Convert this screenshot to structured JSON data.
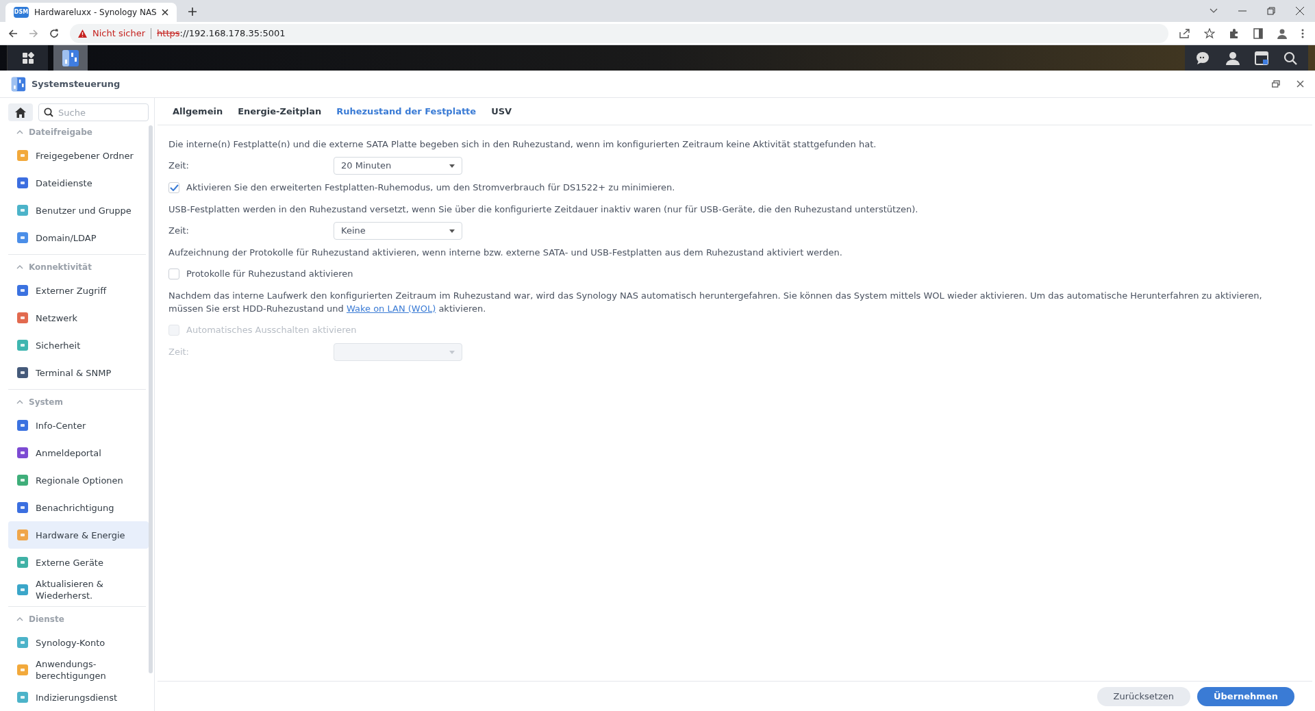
{
  "browser": {
    "tab_title": "Hardwareluxx - Synology NAS",
    "favicon": "DSM",
    "security": "Nicht sicher",
    "url_scheme": "https",
    "url_rest": "://192.168.178.35:5001"
  },
  "window": {
    "title": "Systemsteuerung"
  },
  "sidebar": {
    "search": {
      "placeholder": "Suche"
    },
    "sections": [
      {
        "title": "Dateifreigabe",
        "expanded": true,
        "items": [
          {
            "label": "Freigegebener Ordner",
            "selected": false
          },
          {
            "label": "Dateidienste",
            "selected": false
          },
          {
            "label": "Benutzer und Gruppe",
            "selected": false
          },
          {
            "label": "Domain/LDAP",
            "selected": false
          }
        ]
      },
      {
        "title": "Konnektivität",
        "expanded": true,
        "items": [
          {
            "label": "Externer Zugriff",
            "selected": false
          },
          {
            "label": "Netzwerk",
            "selected": false
          },
          {
            "label": "Sicherheit",
            "selected": false
          },
          {
            "label": "Terminal & SNMP",
            "selected": false
          }
        ]
      },
      {
        "title": "System",
        "expanded": true,
        "items": [
          {
            "label": "Info-Center",
            "selected": false
          },
          {
            "label": "Anmeldeportal",
            "selected": false
          },
          {
            "label": "Regionale Optionen",
            "selected": false
          },
          {
            "label": "Benachrichtigung",
            "selected": false
          },
          {
            "label": "Hardware & Energie",
            "selected": true
          },
          {
            "label": "Externe Geräte",
            "selected": false
          },
          {
            "label": "Aktualisieren & Wiederherst.",
            "selected": false
          }
        ]
      },
      {
        "title": "Dienste",
        "expanded": true,
        "items": [
          {
            "label": "Synology-Konto",
            "selected": false
          },
          {
            "label": "Anwendungs-berechtigungen",
            "selected": false
          },
          {
            "label": "Indizierungsdienst",
            "selected": false
          }
        ]
      }
    ]
  },
  "tabs": [
    {
      "label": "Allgemein",
      "selected": false
    },
    {
      "label": "Energie-Zeitplan",
      "selected": false
    },
    {
      "label": "Ruhezustand der Festplatte",
      "selected": true
    },
    {
      "label": "USV",
      "selected": false
    }
  ],
  "content": [
    {
      "kind": "paragraph",
      "text": "Die interne(n) Festplatte(n) und die externe SATA Platte begeben sich in den Ruhezustand, wenn im konfigurierten Zeitraum keine Aktivität stattgefunden hat."
    },
    {
      "kind": "select",
      "label": "Zeit:",
      "value": "20 Minuten",
      "disabled": false
    },
    {
      "kind": "checkbox",
      "label": "Aktivieren Sie den erweiterten Festplatten-Ruhemodus, um den Stromverbrauch für DS1522+ zu minimieren.",
      "checked": true,
      "disabled": false
    },
    {
      "kind": "paragraph",
      "text": "USB-Festplatten werden in den Ruhezustand versetzt, wenn Sie über die konfigurierte Zeitdauer inaktiv waren (nur für USB-Geräte, die den Ruhezustand unterstützen)."
    },
    {
      "kind": "select",
      "label": "Zeit:",
      "value": "Keine",
      "disabled": false
    },
    {
      "kind": "paragraph",
      "text": "Aufzeichnung der Protokolle für Ruhezustand aktivieren, wenn interne bzw. externe SATA- und USB-Festplatten aus dem Ruhezustand aktiviert werden."
    },
    {
      "kind": "checkbox",
      "label": "Protokolle für Ruhezustand aktivieren",
      "checked": false,
      "disabled": false
    },
    {
      "kind": "paragraph",
      "text": "Nachdem das interne Laufwerk den konfigurierten Zeitraum im Ruhezustand war, wird das Synology NAS automatisch heruntergefahren. Sie können das System mittels WOL wieder aktivieren. Um das automatische Herunterfahren zu aktivieren, müssen Sie erst HDD-Ruhezustand und",
      "link": "Wake on LAN (WOL)",
      "text_after": "aktivieren."
    },
    {
      "kind": "checkbox",
      "label": "Automatisches Ausschalten aktivieren",
      "checked": false,
      "disabled": true
    },
    {
      "kind": "select",
      "label": "Zeit:",
      "disabled": true
    }
  ],
  "footer_buttons": [
    {
      "label": "Zurücksetzen",
      "kind": "secondary"
    },
    {
      "label": "Übernehmen",
      "kind": "primary"
    }
  ]
}
